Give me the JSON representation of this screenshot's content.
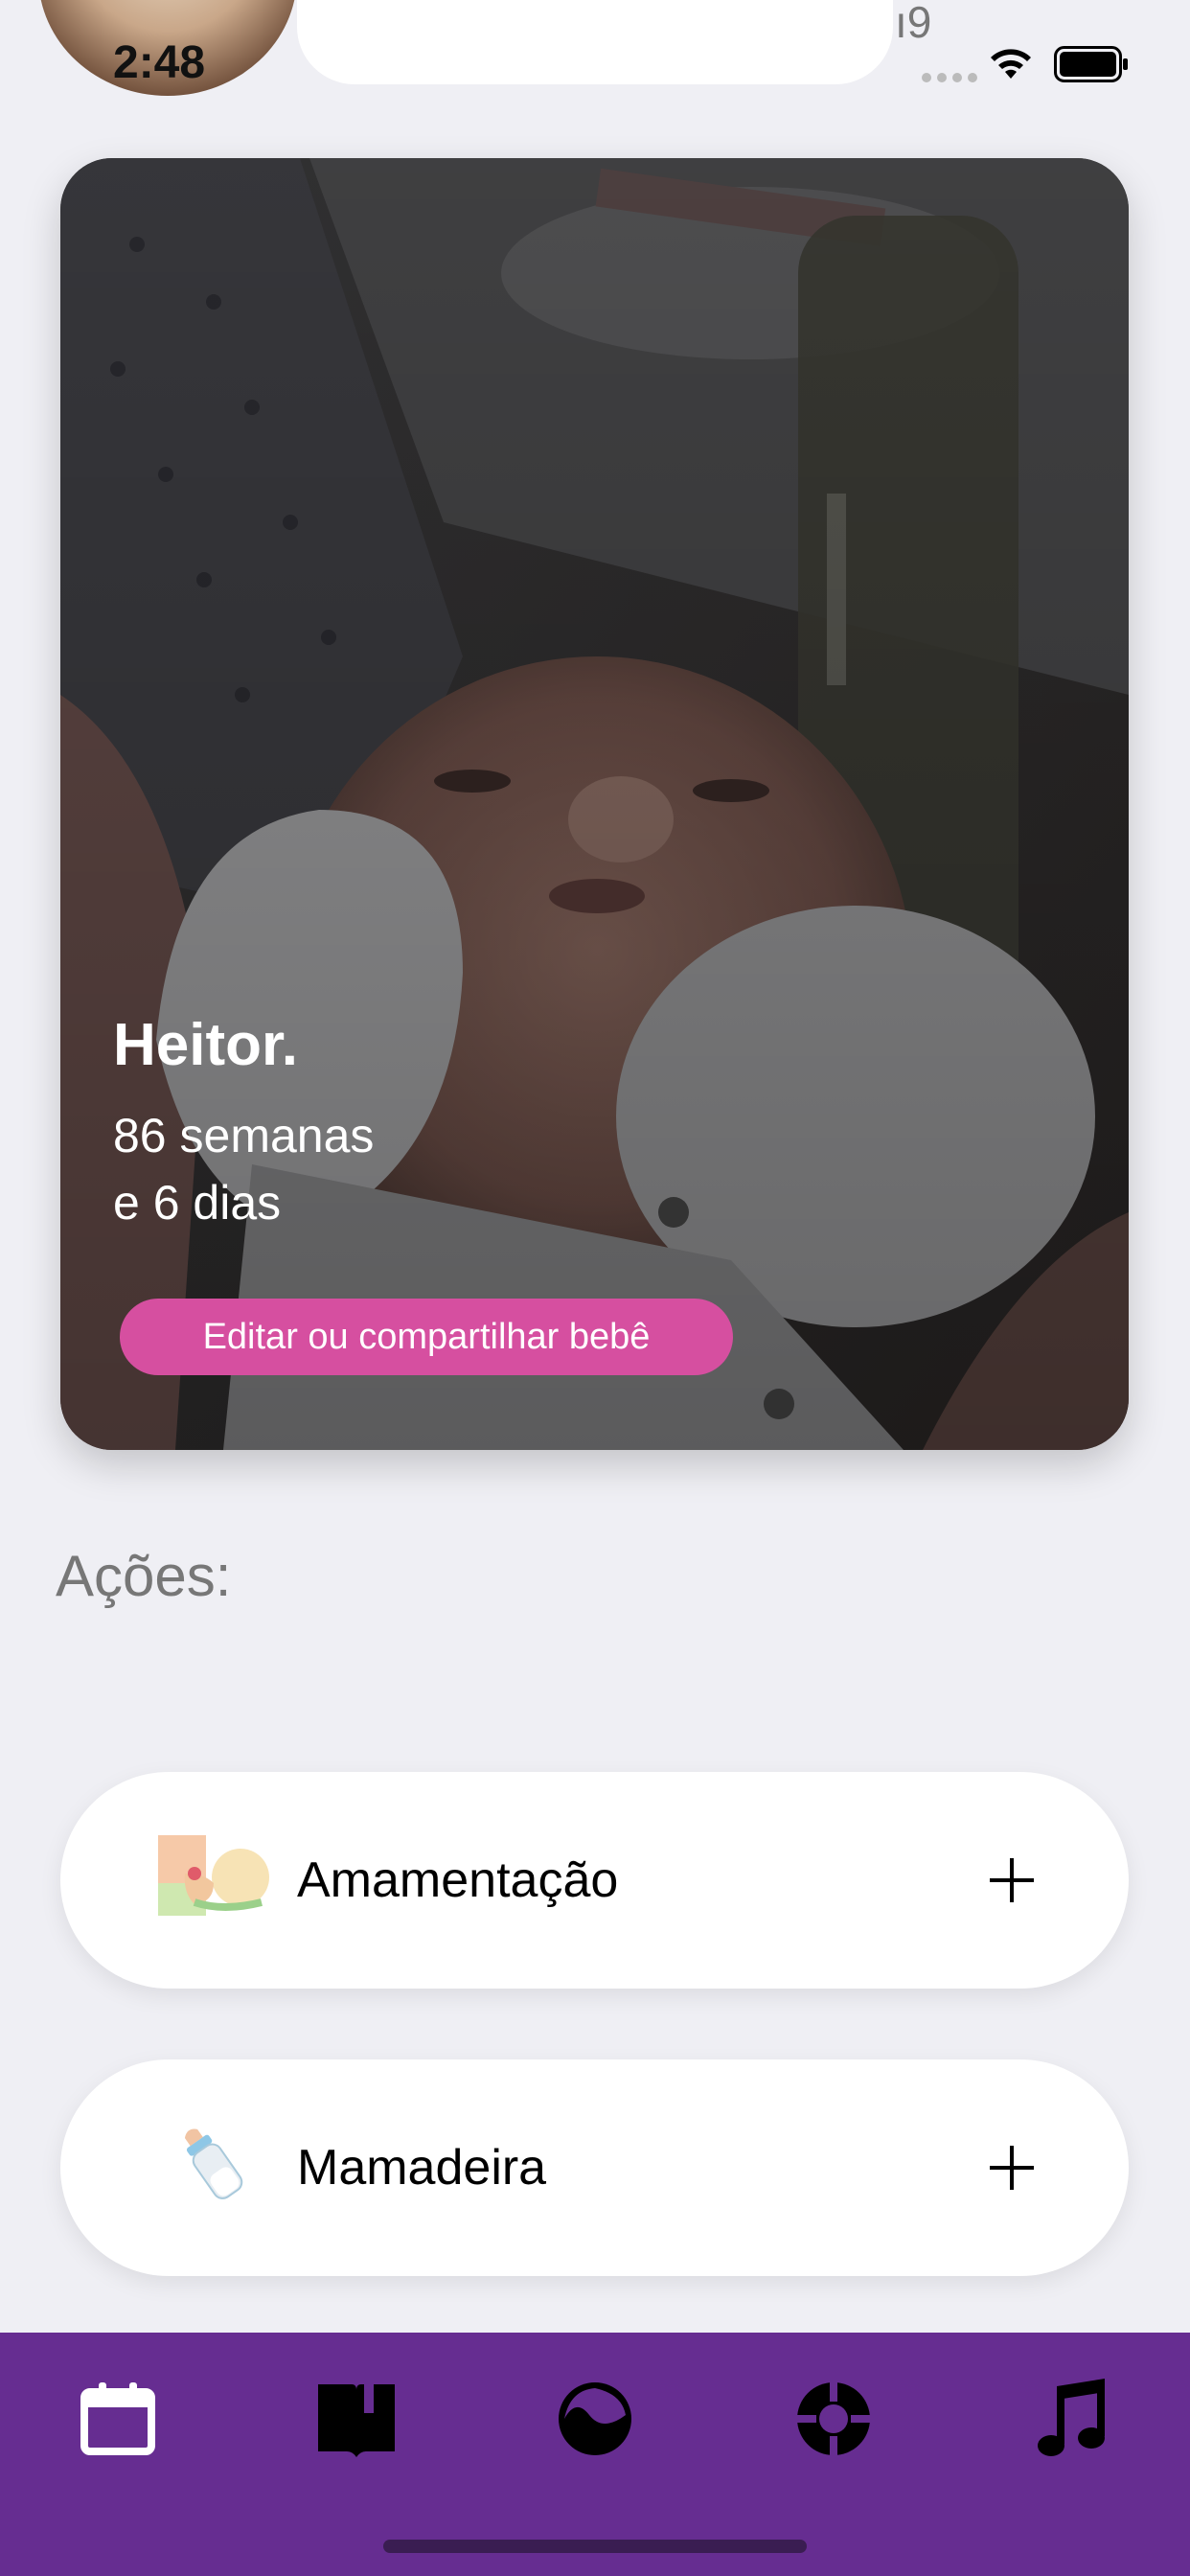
{
  "status_bar": {
    "time": "2:48",
    "carrier_fragment": "ı9"
  },
  "baby_card": {
    "name": "Heitor.",
    "age_line1": "86 semanas",
    "age_line2": "e 6 dias",
    "edit_button_label": "Editar ou compartilhar bebê"
  },
  "actions": {
    "title": "Ações:",
    "items": [
      {
        "label": "Amamentação",
        "icon": "breastfeeding-icon"
      },
      {
        "label": "Mamadeira",
        "icon": "baby-bottle-icon"
      }
    ]
  },
  "tab_bar": {
    "color": "#662d91",
    "tabs": [
      {
        "icon": "calendar-icon"
      },
      {
        "icon": "book-icon"
      },
      {
        "icon": "wave-circle-icon"
      },
      {
        "icon": "lifebuoy-icon"
      },
      {
        "icon": "music-note-icon"
      }
    ]
  },
  "colors": {
    "accent_pink": "#d64fa0",
    "background": "#efeff4"
  }
}
